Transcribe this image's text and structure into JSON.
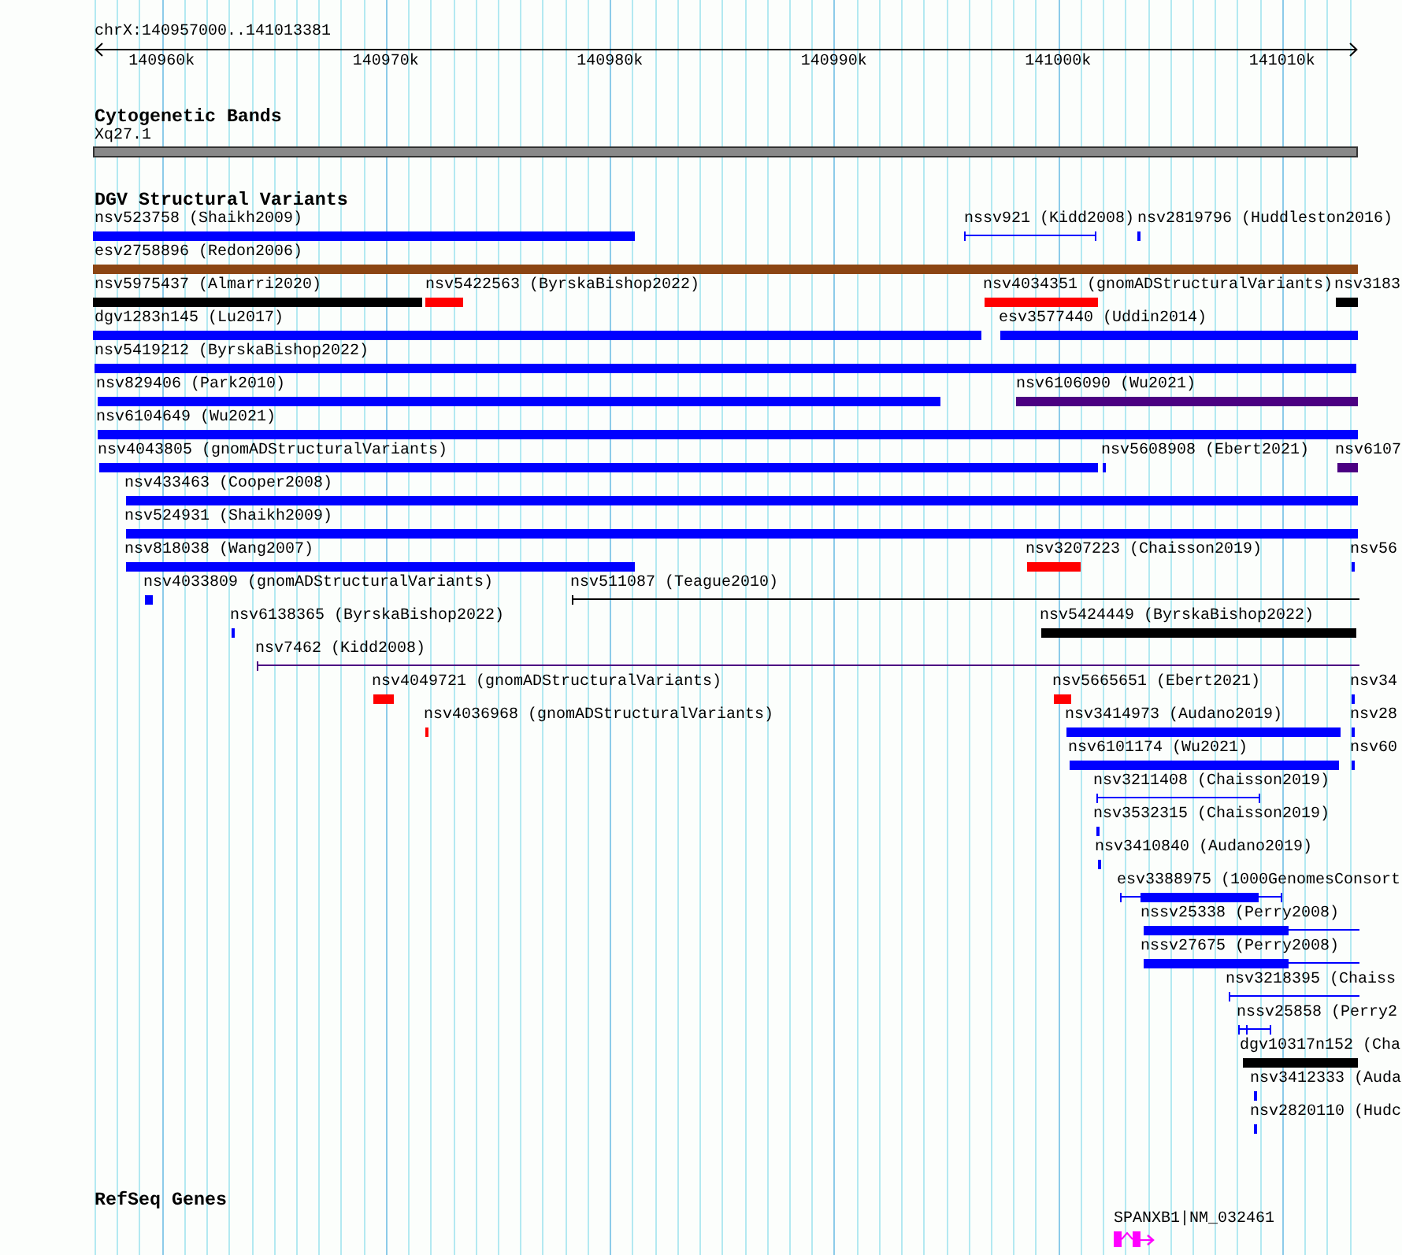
{
  "ruler": {
    "location": "chrX:140957000..141013381",
    "ticks": [
      "140960k",
      "140970k",
      "140980k",
      "140990k",
      "141000k",
      "141010k"
    ]
  },
  "tracks": [
    {
      "kind": "bands",
      "title": "Cytogenetic Bands",
      "features": [
        {
          "label": "Xq27.1"
        }
      ]
    },
    {
      "kind": "variants",
      "title": "DGV Structural Variants",
      "rows": [
        {
          "features": [
            {
              "label": "nsv523758 (Shaikh2009)",
              "kind": "bar",
              "color": "#0000ff"
            },
            {
              "label": "nssv921 (Kidd2008)",
              "kind": "span",
              "color": "#0000ff"
            },
            {
              "label": "nsv2819796 (Huddleston2016)",
              "kind": "bar",
              "color": "#0000ff"
            }
          ]
        },
        {
          "features": [
            {
              "label": "esv2758896 (Redon2006)",
              "kind": "bar",
              "color": "#8b4513"
            }
          ]
        },
        {
          "features": [
            {
              "label": "nsv5975437 (Almarri2020)",
              "kind": "bar",
              "color": "#000000"
            },
            {
              "label": "nsv5422563 (ByrskaBishop2022)",
              "kind": "bar",
              "color": "#ff0000"
            },
            {
              "label": "nsv4034351 (gnomADStructuralVariants)",
              "kind": "bar",
              "color": "#ff0000"
            },
            {
              "label": "nsv3183",
              "kind": "bar",
              "color": "#000000"
            }
          ]
        },
        {
          "features": [
            {
              "label": "dgv1283n145 (Lu2017)",
              "kind": "bar",
              "color": "#0000ff"
            },
            {
              "label": "esv3577440 (Uddin2014)",
              "kind": "bar",
              "color": "#0000ff"
            }
          ]
        },
        {
          "features": [
            {
              "label": "nsv5419212 (ByrskaBishop2022)",
              "kind": "bar",
              "color": "#0000ff"
            }
          ]
        },
        {
          "features": [
            {
              "label": "nsv829406 (Park2010)",
              "kind": "bar",
              "color": "#0000ff"
            },
            {
              "label": "nsv6106090 (Wu2021)",
              "kind": "bar",
              "color": "#4b0082"
            }
          ]
        },
        {
          "features": [
            {
              "label": "nsv6104649 (Wu2021)",
              "kind": "bar",
              "color": "#0000ff"
            }
          ]
        },
        {
          "features": [
            {
              "label": "nsv4043805 (gnomADStructuralVariants)",
              "kind": "bar",
              "color": "#0000ff"
            },
            {
              "label": "nsv5608908 (Ebert2021)",
              "kind": "bar",
              "color": "#0000ff"
            },
            {
              "label": "nsv6107",
              "kind": "bar",
              "color": "#4b0082"
            }
          ]
        },
        {
          "features": [
            {
              "label": "nsv433463 (Cooper2008)",
              "kind": "bar",
              "color": "#0000ff"
            }
          ]
        },
        {
          "features": [
            {
              "label": "nsv524931 (Shaikh2009)",
              "kind": "bar",
              "color": "#0000ff"
            }
          ]
        },
        {
          "features": [
            {
              "label": "nsv818038 (Wang2007)",
              "kind": "bar",
              "color": "#0000ff"
            },
            {
              "label": "nsv3207223 (Chaisson2019)",
              "kind": "bar",
              "color": "#ff0000"
            },
            {
              "label": "nsv56",
              "kind": "bar",
              "color": "#0000ff"
            }
          ]
        },
        {
          "features": [
            {
              "label": "nsv4033809 (gnomADStructuralVariants)",
              "kind": "bar",
              "color": "#0000ff"
            },
            {
              "label": "nsv511087 (Teague2010)",
              "kind": "span",
              "color": "#000000"
            }
          ]
        },
        {
          "features": [
            {
              "label": "nsv6138365 (ByrskaBishop2022)",
              "kind": "bar",
              "color": "#0000ff"
            },
            {
              "label": "nsv5424449 (ByrskaBishop2022)",
              "kind": "bar",
              "color": "#000000"
            }
          ]
        },
        {
          "features": [
            {
              "label": "nsv7462 (Kidd2008)",
              "kind": "span",
              "color": "#4b0082"
            }
          ]
        },
        {
          "features": [
            {
              "label": "nsv4049721 (gnomADStructuralVariants)",
              "kind": "bar",
              "color": "#ff0000"
            },
            {
              "label": "nsv5665651 (Ebert2021)",
              "kind": "bar",
              "color": "#ff0000"
            },
            {
              "label": "nsv34",
              "kind": "bar",
              "color": "#0000ff"
            }
          ]
        },
        {
          "features": [
            {
              "label": "nsv4036968 (gnomADStructuralVariants)",
              "kind": "bar",
              "color": "#ff0000"
            },
            {
              "label": "nsv3414973 (Audano2019)",
              "kind": "bar",
              "color": "#0000ff"
            },
            {
              "label": "nsv28",
              "kind": "bar",
              "color": "#0000ff"
            }
          ]
        },
        {
          "features": [
            {
              "label": "nsv6101174 (Wu2021)",
              "kind": "bar",
              "color": "#0000ff"
            },
            {
              "label": "nsv60",
              "kind": "bar",
              "color": "#0000ff"
            }
          ]
        },
        {
          "features": [
            {
              "label": "nsv3211408 (Chaisson2019)",
              "kind": "span",
              "color": "#0000ff"
            }
          ]
        },
        {
          "features": [
            {
              "label": "nsv3532315 (Chaisson2019)",
              "kind": "bar",
              "color": "#0000ff"
            }
          ]
        },
        {
          "features": [
            {
              "label": "nsv3410840 (Audano2019)",
              "kind": "bar",
              "color": "#0000ff"
            }
          ]
        },
        {
          "features": [
            {
              "label": "esv3388975 (1000GenomesConsort",
              "kind": "mixed",
              "color": "#0000ff"
            }
          ]
        },
        {
          "features": [
            {
              "label": "nssv25338 (Perry2008)",
              "kind": "mixed",
              "color": "#0000ff"
            }
          ]
        },
        {
          "features": [
            {
              "label": "nssv27675 (Perry2008)",
              "kind": "mixed",
              "color": "#0000ff"
            }
          ]
        },
        {
          "features": [
            {
              "label": "nsv3218395 (Chaiss",
              "kind": "span",
              "color": "#0000ff"
            }
          ]
        },
        {
          "features": [
            {
              "label": "nssv25858 (Perry2",
              "kind": "span",
              "color": "#0000ff"
            }
          ]
        },
        {
          "features": [
            {
              "label": "dgv10317n152 (Cha",
              "kind": "bar",
              "color": "#000000"
            }
          ]
        },
        {
          "features": [
            {
              "label": "nsv3412333 (Auda",
              "kind": "bar",
              "color": "#0000ff"
            }
          ]
        },
        {
          "features": [
            {
              "label": "nsv2820110 (Hudc",
              "kind": "bar",
              "color": "#0000ff"
            }
          ]
        }
      ]
    },
    {
      "kind": "genes",
      "title": "RefSeq Genes",
      "features": [
        {
          "label": "SPANXB1|NM_032461"
        }
      ]
    }
  ]
}
